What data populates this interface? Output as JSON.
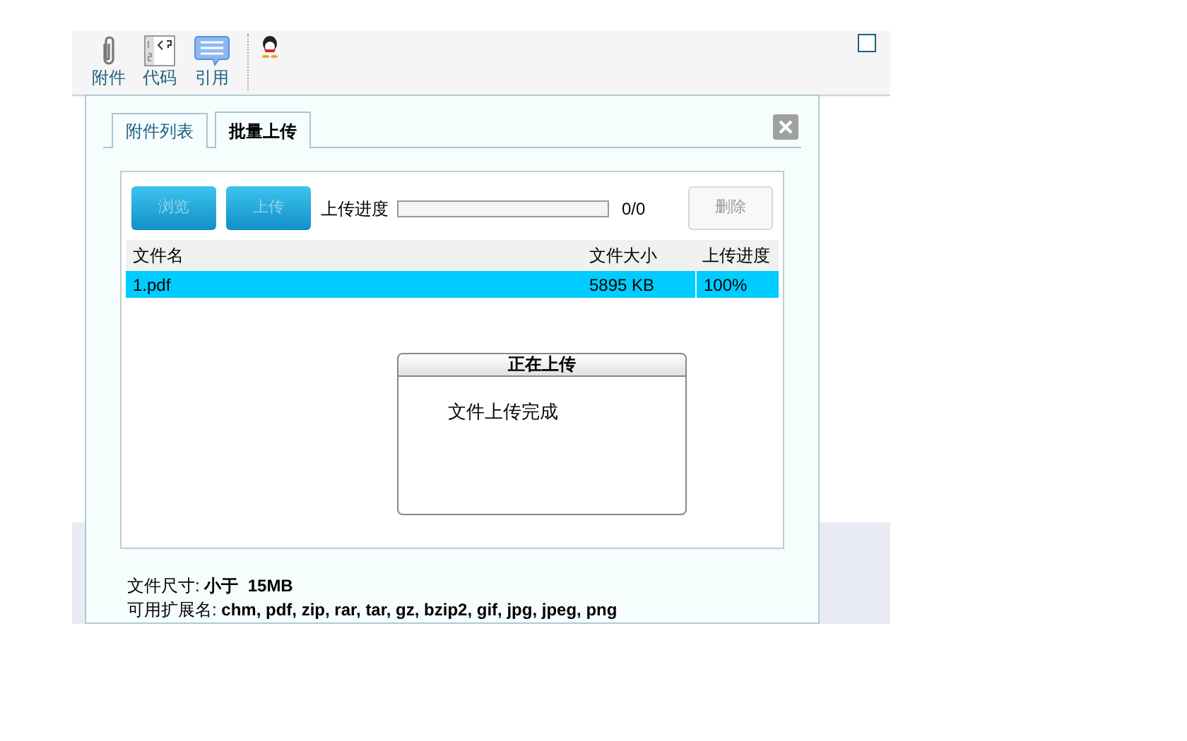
{
  "toolbar": {
    "items": [
      {
        "kind": "attach",
        "label": "附件"
      },
      {
        "kind": "code",
        "label": "代码"
      },
      {
        "kind": "quote",
        "label": "引用"
      },
      {
        "kind": "penguin"
      }
    ],
    "checkbox": {
      "checked": false
    }
  },
  "dialog": {
    "tabs": [
      {
        "label": "附件列表",
        "selected": false
      },
      {
        "label": "批量上传",
        "selected": true
      }
    ],
    "buttons": [
      {
        "label": "浏览",
        "disabled": true
      },
      {
        "label": "上传",
        "disabled": true
      }
    ],
    "progress": {
      "label": "上传进度",
      "level": 0,
      "reading": "0/0"
    },
    "delete_button": {
      "label": "删除",
      "disabled": true
    },
    "table": {
      "columns": [
        "文件名",
        "文件大小",
        "上传进度"
      ],
      "rows": [
        {
          "cells": [
            "1.pdf",
            "5895 KB",
            "100%"
          ],
          "selected": true
        }
      ]
    },
    "popup": {
      "title": "正在上传",
      "message": "文件上传完成"
    },
    "notes": [
      "文件尺寸: **小于  15MB**",
      "可用扩展名: **chm, pdf, zip, rar, tar, gz, bzip2, gif, jpg, jpeg, png**"
    ]
  }
}
